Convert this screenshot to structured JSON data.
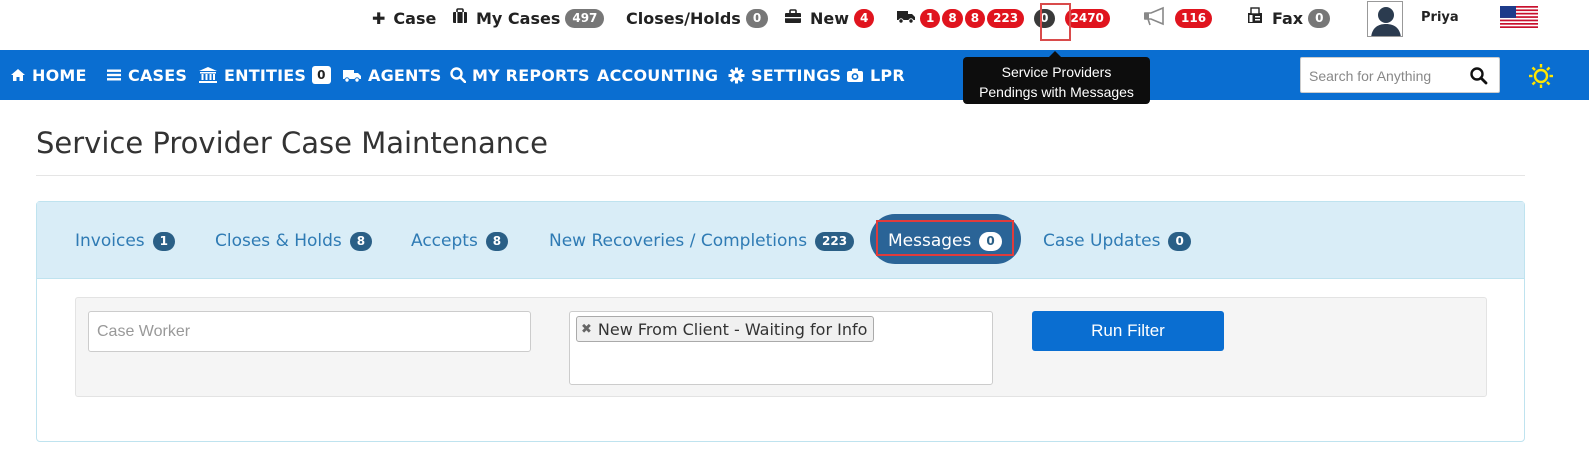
{
  "topbar": {
    "case_label": "Case",
    "my_cases_label": "My Cases",
    "my_cases_count": "497",
    "closes_holds_label": "Closes/Holds",
    "closes_holds_count": "0",
    "new_label": "New",
    "new_count": "4",
    "provider_badges": [
      "1",
      "8",
      "8",
      "223",
      "0",
      "2470"
    ],
    "announcements_count": "116",
    "fax_label": "Fax",
    "fax_count": "0",
    "user_name": "Priya"
  },
  "nav": {
    "home": "HOME",
    "cases": "CASES",
    "entities": "ENTITIES",
    "entities_count": "0",
    "agents": "AGENTS",
    "my_reports": "MY REPORTS",
    "accounting": "ACCOUNTING",
    "settings": "SETTINGS",
    "lpr": "LPR",
    "search_placeholder": "Search for Anything"
  },
  "tooltip": {
    "line1": "Service Providers",
    "line2": "Pendings with Messages"
  },
  "page": {
    "title": "Service Provider Case Maintenance"
  },
  "tabs": [
    {
      "label": "Invoices",
      "count": "1"
    },
    {
      "label": "Closes & Holds",
      "count": "8"
    },
    {
      "label": "Accepts",
      "count": "8"
    },
    {
      "label": "New Recoveries / Completions",
      "count": "223"
    },
    {
      "label": "Messages",
      "count": "0"
    },
    {
      "label": "Case Updates",
      "count": "0"
    }
  ],
  "filter": {
    "case_worker_placeholder": "Case Worker",
    "selected_status": "New From Client - Waiting for Info",
    "run_button": "Run Filter"
  },
  "colors": {
    "nav_bg": "#0a6ed1",
    "badge_red": "#e0141e",
    "tab_active_bg": "#2a6497",
    "tabs_bar_bg": "#d9edf7",
    "highlight": "#e03b3b"
  }
}
